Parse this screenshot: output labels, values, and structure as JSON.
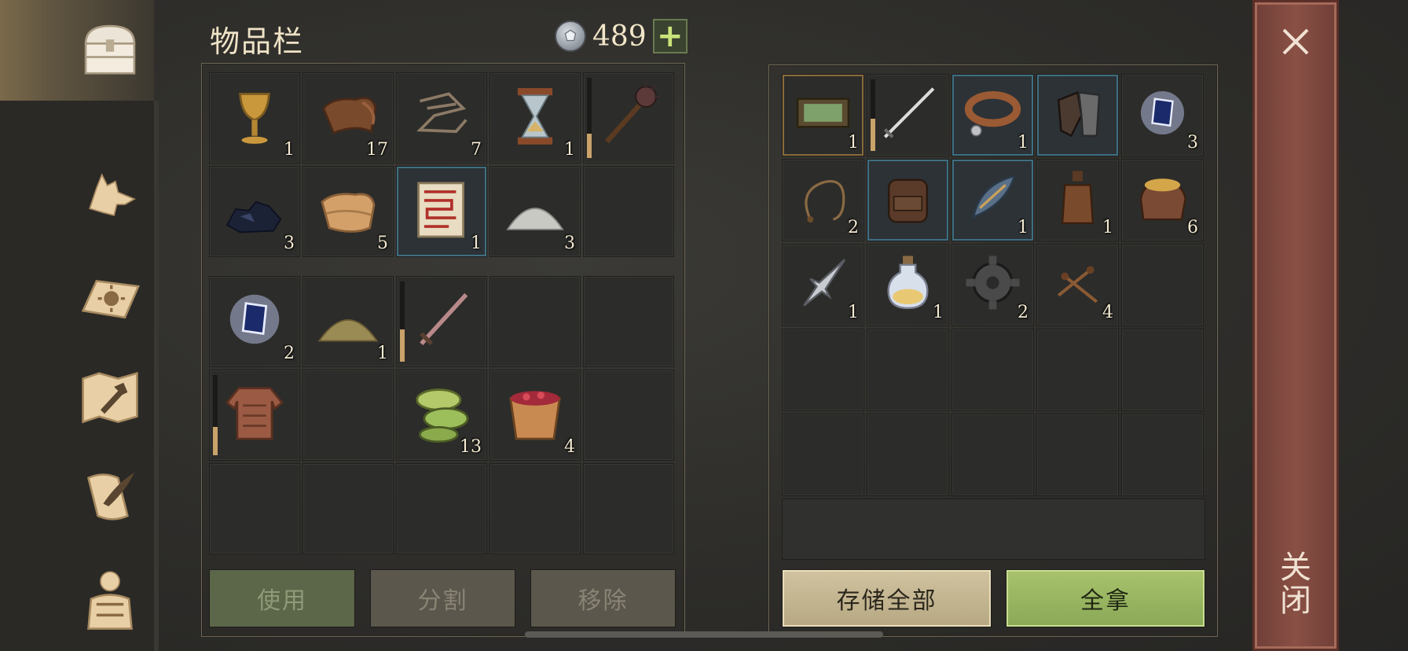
{
  "header": {
    "title": "物品栏",
    "currency_value": "489",
    "plus_label": "+"
  },
  "sidebar": {
    "items": [
      {
        "name": "chest-icon",
        "active": true
      },
      {
        "name": "wolf-icon",
        "active": false
      },
      {
        "name": "sun-book-icon",
        "active": false
      },
      {
        "name": "map-hammer-icon",
        "active": false
      },
      {
        "name": "scroll-quill-icon",
        "active": false
      },
      {
        "name": "character-icon",
        "active": false
      }
    ]
  },
  "inventory": {
    "upper": [
      {
        "icon": "goblet-icon",
        "count": "1"
      },
      {
        "icon": "leather-icon",
        "count": "17"
      },
      {
        "icon": "rope-icon",
        "count": "7"
      },
      {
        "icon": "hourglass-icon",
        "count": "1"
      },
      {
        "icon": "mace-icon",
        "count": "",
        "durability": 0.3
      },
      {
        "icon": "coal-icon",
        "count": "3"
      },
      {
        "icon": "cloth-icon",
        "count": "5"
      },
      {
        "icon": "scroll-icon",
        "count": "1",
        "rare": true
      },
      {
        "icon": "salt-icon",
        "count": "3"
      },
      {
        "icon": "",
        "count": ""
      }
    ],
    "lower": [
      {
        "icon": "crystal-icon",
        "count": "2"
      },
      {
        "icon": "sand-icon",
        "count": "1"
      },
      {
        "icon": "sword-icon",
        "count": "",
        "durability": 0.4
      },
      {
        "icon": "",
        "count": ""
      },
      {
        "icon": "",
        "count": ""
      },
      {
        "icon": "chainmail-icon",
        "count": "",
        "durability": 0.35
      },
      {
        "icon": "",
        "count": ""
      },
      {
        "icon": "cucumber-icon",
        "count": "13"
      },
      {
        "icon": "berry-bucket-icon",
        "count": "4"
      },
      {
        "icon": "",
        "count": ""
      },
      {
        "icon": "",
        "count": ""
      },
      {
        "icon": "",
        "count": ""
      },
      {
        "icon": "",
        "count": ""
      },
      {
        "icon": "",
        "count": ""
      },
      {
        "icon": "",
        "count": ""
      }
    ],
    "buttons": {
      "use": "使用",
      "split": "分割",
      "remove": "移除"
    }
  },
  "storage": {
    "slots": [
      {
        "icon": "frame-icon",
        "count": "1",
        "gold": true
      },
      {
        "icon": "longsword-icon",
        "count": "",
        "durability": 0.45
      },
      {
        "icon": "collar-icon",
        "count": "1",
        "rare": true
      },
      {
        "icon": "gauntlet-icon",
        "count": "",
        "rare": true
      },
      {
        "icon": "crystal-icon",
        "count": "3"
      },
      {
        "icon": "whip-icon",
        "count": "2"
      },
      {
        "icon": "backpack-icon",
        "count": "",
        "rare": true
      },
      {
        "icon": "bow-icon",
        "count": "1",
        "rare": true
      },
      {
        "icon": "bottle-icon",
        "count": "1"
      },
      {
        "icon": "grain-sack-icon",
        "count": "6"
      },
      {
        "icon": "fork-blade-icon",
        "count": "1"
      },
      {
        "icon": "potion-icon",
        "count": "1"
      },
      {
        "icon": "gear-icon",
        "count": "2"
      },
      {
        "icon": "nails-icon",
        "count": "4"
      },
      {
        "icon": "",
        "count": ""
      },
      {
        "icon": "",
        "count": ""
      },
      {
        "icon": "",
        "count": ""
      },
      {
        "icon": "",
        "count": ""
      },
      {
        "icon": "",
        "count": ""
      },
      {
        "icon": "",
        "count": ""
      },
      {
        "icon": "",
        "count": ""
      },
      {
        "icon": "",
        "count": ""
      },
      {
        "icon": "",
        "count": ""
      },
      {
        "icon": "",
        "count": ""
      },
      {
        "icon": "",
        "count": ""
      },
      {
        "icon": "",
        "count": ""
      },
      {
        "icon": "",
        "count": ""
      },
      {
        "icon": "",
        "count": ""
      },
      {
        "icon": "",
        "count": ""
      },
      {
        "icon": "",
        "count": ""
      }
    ],
    "buttons": {
      "store_all": "存储全部",
      "take_all": "全拿"
    }
  },
  "close": {
    "label": "关闭"
  },
  "colors": {
    "accent_green": "#9ab85f",
    "rare_border": "#3e6f82",
    "close_red": "#8a5045"
  }
}
